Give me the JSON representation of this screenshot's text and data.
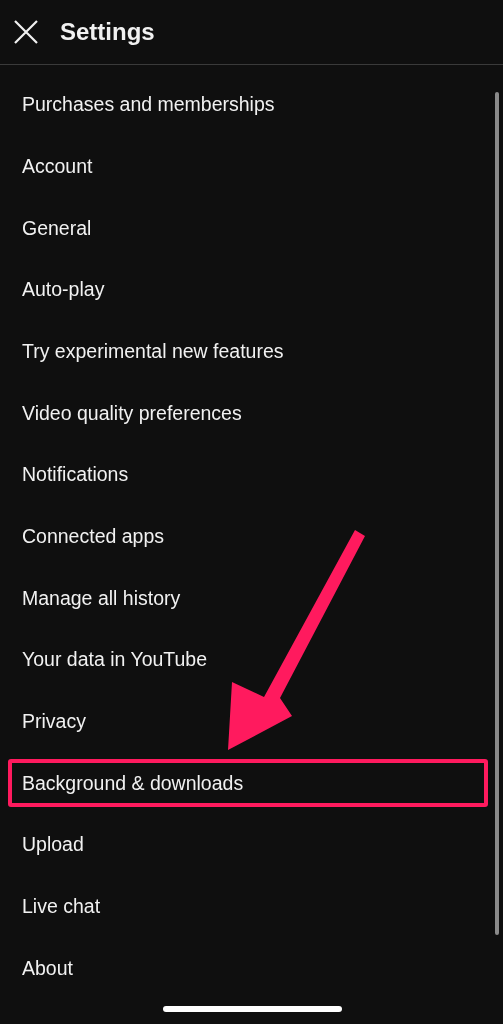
{
  "header": {
    "title": "Settings"
  },
  "items": [
    {
      "label": "Purchases and memberships",
      "highlighted": false
    },
    {
      "label": "Account",
      "highlighted": false
    },
    {
      "label": "General",
      "highlighted": false
    },
    {
      "label": "Auto-play",
      "highlighted": false
    },
    {
      "label": "Try experimental new features",
      "highlighted": false
    },
    {
      "label": "Video quality preferences",
      "highlighted": false
    },
    {
      "label": "Notifications",
      "highlighted": false
    },
    {
      "label": "Connected apps",
      "highlighted": false
    },
    {
      "label": "Manage all history",
      "highlighted": false
    },
    {
      "label": "Your data in YouTube",
      "highlighted": false
    },
    {
      "label": "Privacy",
      "highlighted": false
    },
    {
      "label": "Background & downloads",
      "highlighted": true
    },
    {
      "label": "Upload",
      "highlighted": false
    },
    {
      "label": "Live chat",
      "highlighted": false
    },
    {
      "label": "About",
      "highlighted": false
    }
  ]
}
